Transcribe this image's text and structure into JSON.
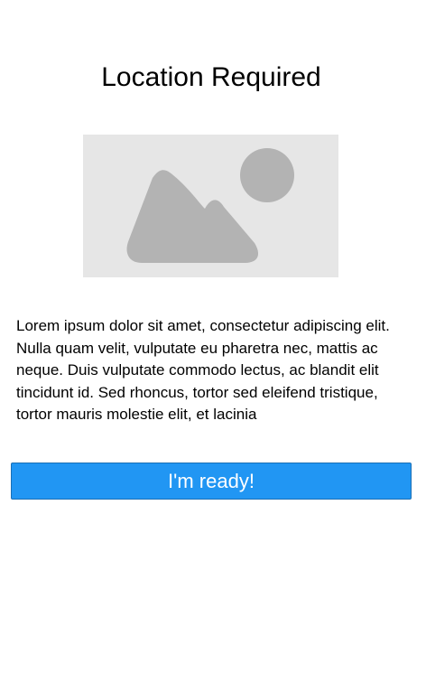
{
  "header": {
    "title": "Location Required"
  },
  "illustration": {
    "icon": "image-placeholder-icon",
    "background_color": "#e6e6e6",
    "shape_color": "#b3b3b3"
  },
  "content": {
    "paragraph": "Lorem ipsum dolor sit amet, consectetur adipiscing elit. Nulla quam velit, vulputate eu pharetra nec, mattis ac neque. Duis vulputate commodo lectus, ac blandit elit tincidunt id. Sed rhoncus, tortor sed eleifend tristique, tortor mauris molestie elit, et lacinia"
  },
  "actions": {
    "ready_label": "I'm ready!",
    "ready_color": "#2196f3"
  }
}
